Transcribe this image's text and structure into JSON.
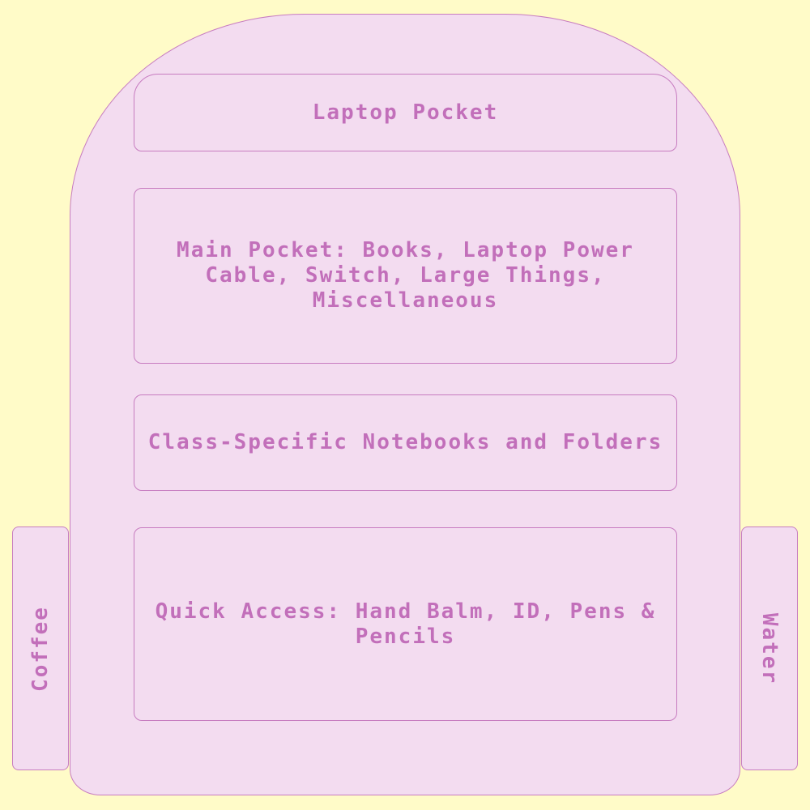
{
  "pockets": {
    "laptop": "Laptop Pocket",
    "main": "Main Pocket: Books, Laptop Power Cable, Switch, Large Things, Miscellaneous",
    "class": "Class-Specific Notebooks and Folders",
    "quick": "Quick Access: Hand Balm, ID, Pens & Pencils"
  },
  "sides": {
    "left": "Coffee",
    "right": "Water"
  },
  "colors": {
    "background": "#fffbc8",
    "bag_fill": "#f3dcf0",
    "outline": "#c77cc0",
    "text": "#c26fba"
  }
}
